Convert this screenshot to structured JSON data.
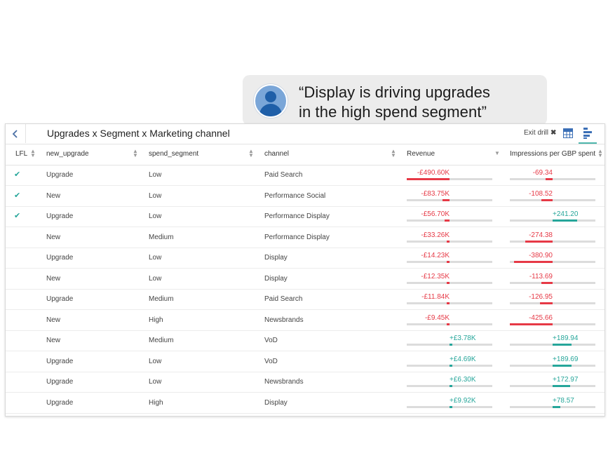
{
  "quote": {
    "line1": "“Display is driving upgrades",
    "line2": "in the high spend segment”"
  },
  "header": {
    "title": "Upgrades x Segment x Marketing channel",
    "exit_drill": "Exit drill",
    "exit_x": "✖"
  },
  "columns": {
    "lfl": "LFL",
    "new_upgrade": "new_upgrade",
    "spend_segment": "spend_segment",
    "channel": "channel",
    "revenue": "Revenue",
    "impressions": "Impressions per GBP spent"
  },
  "colors": {
    "negative": "#e63946",
    "positive": "#26a69a"
  },
  "rows": [
    {
      "lfl": true,
      "new_upgrade": "Upgrade",
      "spend_segment": "Low",
      "channel": "Paid Search",
      "revenue": "-£490.60K",
      "revenue_value": -490.6,
      "impressions": "-69.34",
      "impressions_value": -69.34
    },
    {
      "lfl": true,
      "new_upgrade": "New",
      "spend_segment": "Low",
      "channel": "Performance Social",
      "revenue": "-£83.75K",
      "revenue_value": -83.75,
      "impressions": "-108.52",
      "impressions_value": -108.52
    },
    {
      "lfl": true,
      "new_upgrade": "Upgrade",
      "spend_segment": "Low",
      "channel": "Performance Display",
      "revenue": "-£56.70K",
      "revenue_value": -56.7,
      "impressions": "+241.20",
      "impressions_value": 241.2
    },
    {
      "lfl": false,
      "new_upgrade": "New",
      "spend_segment": "Medium",
      "channel": "Performance Display",
      "revenue": "-£33.26K",
      "revenue_value": -33.26,
      "impressions": "-274.38",
      "impressions_value": -274.38
    },
    {
      "lfl": false,
      "new_upgrade": "Upgrade",
      "spend_segment": "Low",
      "channel": "Display",
      "revenue": "-£14.23K",
      "revenue_value": -14.23,
      "impressions": "-380.90",
      "impressions_value": -380.9
    },
    {
      "lfl": false,
      "new_upgrade": "New",
      "spend_segment": "Low",
      "channel": "Display",
      "revenue": "-£12.35K",
      "revenue_value": -12.35,
      "impressions": "-113.69",
      "impressions_value": -113.69
    },
    {
      "lfl": false,
      "new_upgrade": "Upgrade",
      "spend_segment": "Medium",
      "channel": "Paid Search",
      "revenue": "-£11.84K",
      "revenue_value": -11.84,
      "impressions": "-126.95",
      "impressions_value": -126.95
    },
    {
      "lfl": false,
      "new_upgrade": "New",
      "spend_segment": "High",
      "channel": "Newsbrands",
      "revenue": "-£9.45K",
      "revenue_value": -9.45,
      "impressions": "-425.66",
      "impressions_value": -425.66
    },
    {
      "lfl": false,
      "new_upgrade": "New",
      "spend_segment": "Medium",
      "channel": "VoD",
      "revenue": "+£3.78K",
      "revenue_value": 3.78,
      "impressions": "+189.94",
      "impressions_value": 189.94
    },
    {
      "lfl": false,
      "new_upgrade": "Upgrade",
      "spend_segment": "Low",
      "channel": "VoD",
      "revenue": "+£4.69K",
      "revenue_value": 4.69,
      "impressions": "+189.69",
      "impressions_value": 189.69
    },
    {
      "lfl": false,
      "new_upgrade": "Upgrade",
      "spend_segment": "Low",
      "channel": "Newsbrands",
      "revenue": "+£6.30K",
      "revenue_value": 6.3,
      "impressions": "+172.97",
      "impressions_value": 172.97
    },
    {
      "lfl": false,
      "new_upgrade": "Upgrade",
      "spend_segment": "High",
      "channel": "Display",
      "revenue": "+£9.92K",
      "revenue_value": 9.92,
      "impressions": "+78.57",
      "impressions_value": 78.57
    }
  ]
}
